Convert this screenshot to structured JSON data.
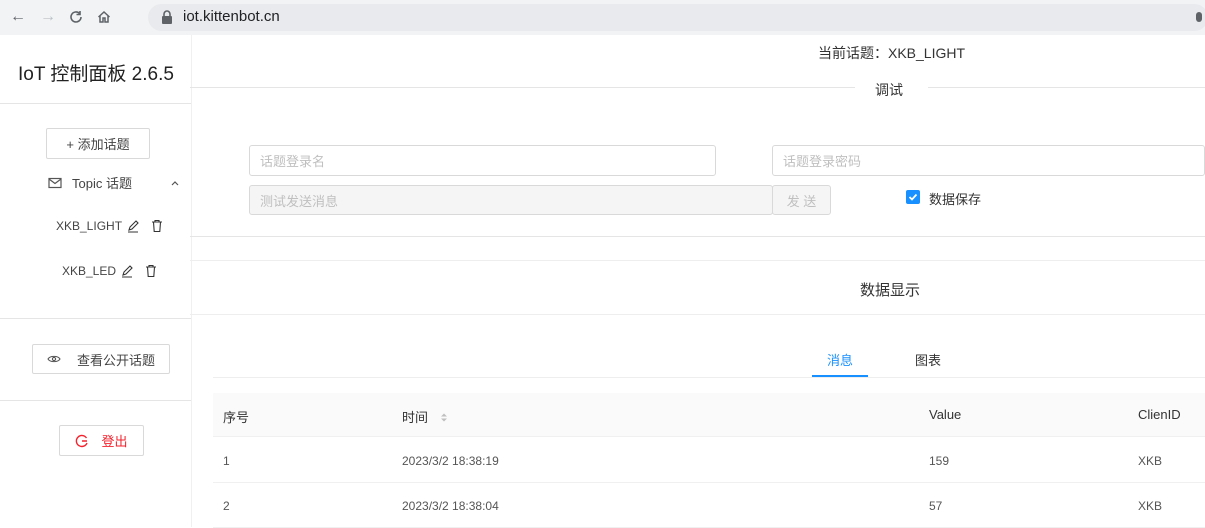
{
  "browser": {
    "url": "iot.kittenbot.cn",
    "back_icon": "←",
    "forward_icon": "→",
    "reload_icon": "C",
    "home_icon": "⌂"
  },
  "sidebar": {
    "title": "IoT 控制面板 2.6.5",
    "add_topic_label": "+ 添加话题",
    "topic_menu_label": "Topic 话题",
    "topics": [
      {
        "name": "XKB_LIGHT"
      },
      {
        "name": "XKB_LED"
      }
    ],
    "public_topics_label": "查看公开话题",
    "logout_label": "登出"
  },
  "main": {
    "current_topic_label": "当前话题：XKB_LIGHT",
    "debug_section": {
      "title": "调试",
      "username_placeholder": "话题登录名",
      "password_placeholder": "话题登录密码",
      "message_placeholder": "测试发送消息",
      "send_label": "发 送",
      "save_data_label": "数据保存",
      "save_data_checked": true
    },
    "data_display": {
      "title": "数据显示",
      "tabs": [
        {
          "label": "消息",
          "active": true
        },
        {
          "label": "图表",
          "active": false
        }
      ],
      "columns": [
        "序号",
        "时间",
        "Value",
        "ClienID"
      ],
      "rows": [
        {
          "index": "1",
          "time": "2023/3/2 18:38:19",
          "value": "159",
          "client": "XKB"
        },
        {
          "index": "2",
          "time": "2023/3/2 18:38:04",
          "value": "57",
          "client": "XKB"
        }
      ]
    }
  },
  "colors": {
    "accent": "#1890ff",
    "logout": "#f5222d"
  }
}
